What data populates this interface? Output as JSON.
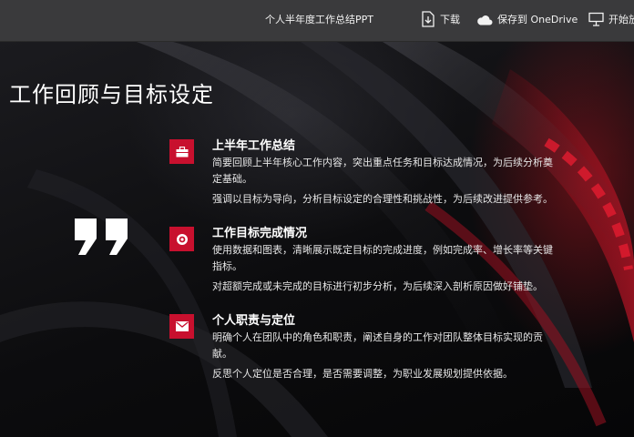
{
  "toolbar": {
    "doc_title": "个人半年度工作总结PPT",
    "download_label": "下载",
    "onedrive_label": "保存到 OneDrive",
    "present_label": "开始放"
  },
  "slide": {
    "title": "工作回顾与目标设定",
    "items": [
      {
        "heading": "上半年工作总结",
        "lines": [
          "简要回顾上半年核心工作内容，突出重点任务和目标达成情况，为后续分析奠定基础。",
          "强调以目标为导向，分析目标设定的合理性和挑战性，为后续改进提供参考。"
        ]
      },
      {
        "heading": "工作目标完成情况",
        "lines": [
          "使用数据和图表，清晰展示既定目标的完成进度，例如完成率、增长率等关键指标。",
          "对超额完成或未完成的目标进行初步分析，为后续深入剖析原因做好铺垫。"
        ]
      },
      {
        "heading": "个人职责与定位",
        "lines": [
          "明确个人在团队中的角色和职责，阐述自身的工作对团队整体目标实现的贡献。",
          "反思个人定位是否合理，是否需要调整，为职业发展规划提供依据。"
        ]
      }
    ]
  },
  "colors": {
    "accent": "#c8102e",
    "toolbar_bg": "#3a3a3c"
  },
  "icons": [
    "download-icon",
    "cloud-icon",
    "presentation-icon",
    "quote-icon",
    "briefcase-icon",
    "target-icon",
    "envelope-icon"
  ]
}
